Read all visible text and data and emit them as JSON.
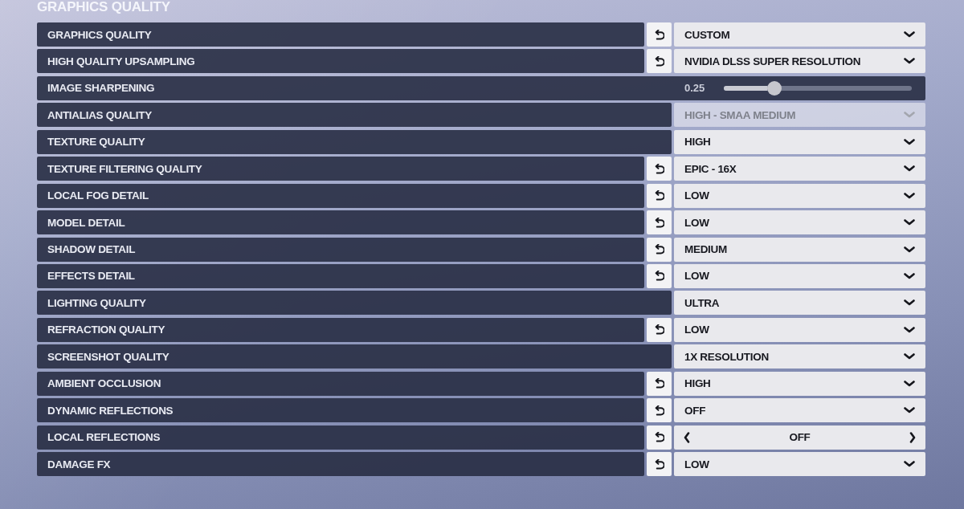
{
  "title": "GRAPHICS QUALITY",
  "settings": [
    {
      "label": "GRAPHICS QUALITY",
      "kind": "dropdown",
      "resettable": true,
      "disabled": false,
      "value": "CUSTOM"
    },
    {
      "label": "HIGH QUALITY UPSAMPLING",
      "kind": "dropdown",
      "resettable": true,
      "disabled": false,
      "value": "NVIDIA DLSS SUPER RESOLUTION"
    },
    {
      "label": "IMAGE SHARPENING",
      "kind": "slider",
      "resettable": false,
      "disabled": false,
      "reading": "0.25",
      "level": 0.27
    },
    {
      "label": "ANTIALIAS QUALITY",
      "kind": "dropdown",
      "resettable": false,
      "disabled": true,
      "value": "HIGH - SMAA MEDIUM"
    },
    {
      "label": "TEXTURE QUALITY",
      "kind": "dropdown",
      "resettable": false,
      "disabled": false,
      "value": "HIGH"
    },
    {
      "label": "TEXTURE FILTERING QUALITY",
      "kind": "dropdown",
      "resettable": true,
      "disabled": false,
      "value": "EPIC - 16X"
    },
    {
      "label": "LOCAL FOG DETAIL",
      "kind": "dropdown",
      "resettable": true,
      "disabled": false,
      "value": "LOW"
    },
    {
      "label": "MODEL DETAIL",
      "kind": "dropdown",
      "resettable": true,
      "disabled": false,
      "value": "LOW"
    },
    {
      "label": "SHADOW DETAIL",
      "kind": "dropdown",
      "resettable": true,
      "disabled": false,
      "value": "MEDIUM"
    },
    {
      "label": "EFFECTS DETAIL",
      "kind": "dropdown",
      "resettable": true,
      "disabled": false,
      "value": "LOW"
    },
    {
      "label": "LIGHTING QUALITY",
      "kind": "dropdown",
      "resettable": false,
      "disabled": false,
      "value": "ULTRA"
    },
    {
      "label": "REFRACTION QUALITY",
      "kind": "dropdown",
      "resettable": true,
      "disabled": false,
      "value": "LOW"
    },
    {
      "label": "SCREENSHOT QUALITY",
      "kind": "dropdown",
      "resettable": false,
      "disabled": false,
      "value": "1X RESOLUTION"
    },
    {
      "label": "AMBIENT OCCLUSION",
      "kind": "dropdown",
      "resettable": true,
      "disabled": false,
      "value": "HIGH"
    },
    {
      "label": "DYNAMIC REFLECTIONS",
      "kind": "dropdown",
      "resettable": true,
      "disabled": false,
      "value": "OFF"
    },
    {
      "label": "LOCAL REFLECTIONS",
      "kind": "arrows",
      "resettable": true,
      "disabled": false,
      "value": "OFF"
    },
    {
      "label": "DAMAGE FX",
      "kind": "dropdown",
      "resettable": true,
      "disabled": false,
      "value": "LOW"
    }
  ]
}
